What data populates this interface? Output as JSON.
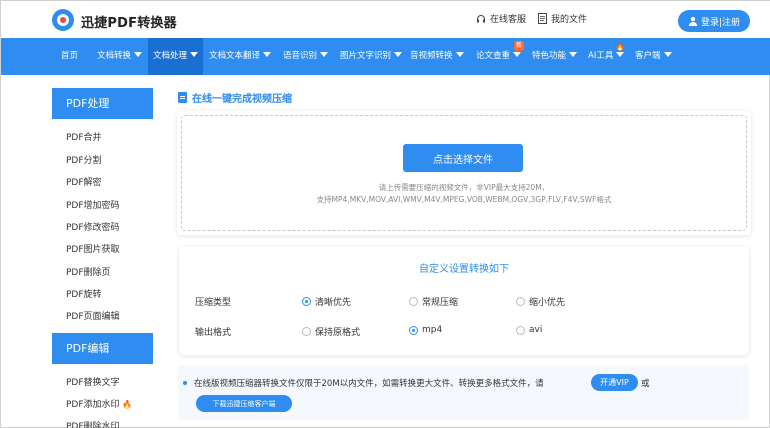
{
  "header": {
    "brand": "迅捷PDF转换器",
    "service_label": "在线客服",
    "files_label": "我的文件",
    "login_label": "登录|注册"
  },
  "nav": {
    "items": [
      {
        "label": "首页"
      },
      {
        "label": "文档转换"
      },
      {
        "label": "文档处理"
      },
      {
        "label": "文档文本翻译"
      },
      {
        "label": "语音识别"
      },
      {
        "label": "图片文字识别"
      },
      {
        "label": "音视频转换"
      },
      {
        "label": "论文查重"
      },
      {
        "label": "特色功能"
      },
      {
        "label": "AI工具"
      },
      {
        "label": "客户端"
      }
    ],
    "new_badge": "新"
  },
  "sidebar": {
    "section1_title": "PDF处理",
    "section1_items": [
      "PDF合并",
      "PDF分割",
      "PDF解密",
      "PDF增加密码",
      "PDF修改密码",
      "PDF图片获取",
      "PDF删除页",
      "PDF旋转",
      "PDF页面编辑"
    ],
    "section2_title": "PDF编辑",
    "section2_items": [
      "PDF替换文字",
      "PDF添加水印",
      "PDF删除水印"
    ]
  },
  "main": {
    "title": "在线一键完成视频压缩",
    "upload_button": "点击选择文件",
    "upload_tip1": "请上传需要压缩的视频文件，非VIP最大支持20M，",
    "upload_tip2": "支持MP4,MKV,MOV,AVI,WMV,M4V,MPEG,VOB,WEBM,OGV,3GP,FLV,F4V,SWF格式"
  },
  "settings": {
    "title": "自定义设置转换如下",
    "compression_label": "压缩类型",
    "compression_options": [
      {
        "label": "清晰优先",
        "checked": true
      },
      {
        "label": "常规压缩",
        "checked": false
      },
      {
        "label": "缩小优先",
        "checked": false
      }
    ],
    "format_label": "输出格式",
    "format_options": [
      {
        "label": "保持原格式",
        "checked": false
      },
      {
        "label": "mp4",
        "checked": true
      },
      {
        "label": "avi",
        "checked": false
      }
    ]
  },
  "notice": {
    "text": "在线版视频压缩器转换文件仅限于20M以内文件，如需转换更大文件、转换更多格式文件，请",
    "vip_button": "开通VIP",
    "or_text": "或",
    "download_button": "下载迅捷压缩客户端"
  },
  "colors": {
    "primary": "#2f8cf0",
    "nav_active": "#1a6fd2",
    "fire": "#ff5a1f"
  }
}
